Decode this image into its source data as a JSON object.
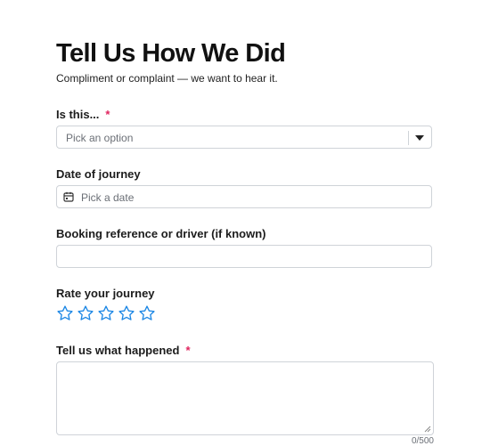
{
  "form": {
    "title": "Tell Us How We Did",
    "subtitle": "Compliment or complaint — we want to hear it."
  },
  "fields": {
    "type": {
      "label": "Is this...",
      "required_mark": "*",
      "placeholder": "Pick an option"
    },
    "date": {
      "label": "Date of journey",
      "placeholder": "Pick a date"
    },
    "reference": {
      "label": "Booking reference or driver (if known)",
      "value": ""
    },
    "rating": {
      "label": "Rate your journey",
      "max_stars": 5,
      "selected": 0
    },
    "details": {
      "label": "Tell us what happened",
      "required_mark": "*",
      "value": "",
      "counter": "0/500"
    }
  },
  "icons": {
    "dropdown": "chevron-down-icon",
    "calendar": "calendar-icon",
    "star": "star-outline-icon"
  },
  "colors": {
    "required": "#e0245e",
    "star": "#1e88e5",
    "border": "#cfd3d8"
  }
}
